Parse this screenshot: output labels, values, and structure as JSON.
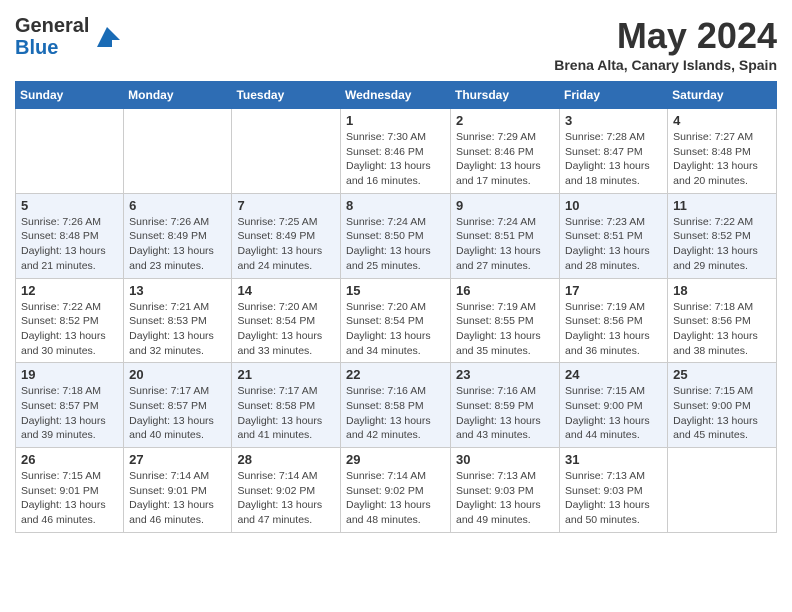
{
  "header": {
    "logo_line1": "General",
    "logo_line2": "Blue",
    "month_title": "May 2024",
    "subtitle": "Brena Alta, Canary Islands, Spain"
  },
  "weekdays": [
    "Sunday",
    "Monday",
    "Tuesday",
    "Wednesday",
    "Thursday",
    "Friday",
    "Saturday"
  ],
  "weeks": [
    [
      {
        "day": "",
        "info": ""
      },
      {
        "day": "",
        "info": ""
      },
      {
        "day": "",
        "info": ""
      },
      {
        "day": "1",
        "info": "Sunrise: 7:30 AM\nSunset: 8:46 PM\nDaylight: 13 hours and 16 minutes."
      },
      {
        "day": "2",
        "info": "Sunrise: 7:29 AM\nSunset: 8:46 PM\nDaylight: 13 hours and 17 minutes."
      },
      {
        "day": "3",
        "info": "Sunrise: 7:28 AM\nSunset: 8:47 PM\nDaylight: 13 hours and 18 minutes."
      },
      {
        "day": "4",
        "info": "Sunrise: 7:27 AM\nSunset: 8:48 PM\nDaylight: 13 hours and 20 minutes."
      }
    ],
    [
      {
        "day": "5",
        "info": "Sunrise: 7:26 AM\nSunset: 8:48 PM\nDaylight: 13 hours and 21 minutes."
      },
      {
        "day": "6",
        "info": "Sunrise: 7:26 AM\nSunset: 8:49 PM\nDaylight: 13 hours and 23 minutes."
      },
      {
        "day": "7",
        "info": "Sunrise: 7:25 AM\nSunset: 8:49 PM\nDaylight: 13 hours and 24 minutes."
      },
      {
        "day": "8",
        "info": "Sunrise: 7:24 AM\nSunset: 8:50 PM\nDaylight: 13 hours and 25 minutes."
      },
      {
        "day": "9",
        "info": "Sunrise: 7:24 AM\nSunset: 8:51 PM\nDaylight: 13 hours and 27 minutes."
      },
      {
        "day": "10",
        "info": "Sunrise: 7:23 AM\nSunset: 8:51 PM\nDaylight: 13 hours and 28 minutes."
      },
      {
        "day": "11",
        "info": "Sunrise: 7:22 AM\nSunset: 8:52 PM\nDaylight: 13 hours and 29 minutes."
      }
    ],
    [
      {
        "day": "12",
        "info": "Sunrise: 7:22 AM\nSunset: 8:52 PM\nDaylight: 13 hours and 30 minutes."
      },
      {
        "day": "13",
        "info": "Sunrise: 7:21 AM\nSunset: 8:53 PM\nDaylight: 13 hours and 32 minutes."
      },
      {
        "day": "14",
        "info": "Sunrise: 7:20 AM\nSunset: 8:54 PM\nDaylight: 13 hours and 33 minutes."
      },
      {
        "day": "15",
        "info": "Sunrise: 7:20 AM\nSunset: 8:54 PM\nDaylight: 13 hours and 34 minutes."
      },
      {
        "day": "16",
        "info": "Sunrise: 7:19 AM\nSunset: 8:55 PM\nDaylight: 13 hours and 35 minutes."
      },
      {
        "day": "17",
        "info": "Sunrise: 7:19 AM\nSunset: 8:56 PM\nDaylight: 13 hours and 36 minutes."
      },
      {
        "day": "18",
        "info": "Sunrise: 7:18 AM\nSunset: 8:56 PM\nDaylight: 13 hours and 38 minutes."
      }
    ],
    [
      {
        "day": "19",
        "info": "Sunrise: 7:18 AM\nSunset: 8:57 PM\nDaylight: 13 hours and 39 minutes."
      },
      {
        "day": "20",
        "info": "Sunrise: 7:17 AM\nSunset: 8:57 PM\nDaylight: 13 hours and 40 minutes."
      },
      {
        "day": "21",
        "info": "Sunrise: 7:17 AM\nSunset: 8:58 PM\nDaylight: 13 hours and 41 minutes."
      },
      {
        "day": "22",
        "info": "Sunrise: 7:16 AM\nSunset: 8:58 PM\nDaylight: 13 hours and 42 minutes."
      },
      {
        "day": "23",
        "info": "Sunrise: 7:16 AM\nSunset: 8:59 PM\nDaylight: 13 hours and 43 minutes."
      },
      {
        "day": "24",
        "info": "Sunrise: 7:15 AM\nSunset: 9:00 PM\nDaylight: 13 hours and 44 minutes."
      },
      {
        "day": "25",
        "info": "Sunrise: 7:15 AM\nSunset: 9:00 PM\nDaylight: 13 hours and 45 minutes."
      }
    ],
    [
      {
        "day": "26",
        "info": "Sunrise: 7:15 AM\nSunset: 9:01 PM\nDaylight: 13 hours and 46 minutes."
      },
      {
        "day": "27",
        "info": "Sunrise: 7:14 AM\nSunset: 9:01 PM\nDaylight: 13 hours and 46 minutes."
      },
      {
        "day": "28",
        "info": "Sunrise: 7:14 AM\nSunset: 9:02 PM\nDaylight: 13 hours and 47 minutes."
      },
      {
        "day": "29",
        "info": "Sunrise: 7:14 AM\nSunset: 9:02 PM\nDaylight: 13 hours and 48 minutes."
      },
      {
        "day": "30",
        "info": "Sunrise: 7:13 AM\nSunset: 9:03 PM\nDaylight: 13 hours and 49 minutes."
      },
      {
        "day": "31",
        "info": "Sunrise: 7:13 AM\nSunset: 9:03 PM\nDaylight: 13 hours and 50 minutes."
      },
      {
        "day": "",
        "info": ""
      }
    ]
  ]
}
